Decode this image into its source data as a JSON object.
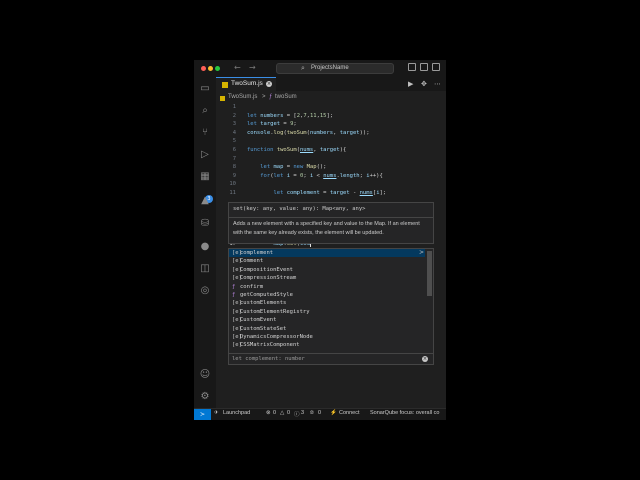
{
  "window": {
    "search_text": "ProjectsName",
    "colors": {
      "close": "#ff5f57",
      "minimize": "#febc2e",
      "zoom": "#28c840",
      "accent": "#0078d4"
    }
  },
  "nav": {
    "back_icon": "arrow-left-icon",
    "forward_icon": "arrow-right-icon"
  },
  "activity_bar": {
    "items": [
      "explorer-icon",
      "search-icon",
      "source-control-icon",
      "run-debug-icon",
      "extensions-icon",
      "azure-icon",
      "database-icon",
      "github-icon",
      "docker-icon",
      "copilot-icon"
    ],
    "extensions_badge": "3",
    "bottom": [
      "accounts-icon",
      "settings-icon"
    ]
  },
  "tab": {
    "label": "TwoSum.js"
  },
  "breadcrumb": {
    "file": "TwoSum.js",
    "separator": ">",
    "symbol": "twoSum"
  },
  "editor": {
    "lines": [
      {
        "n": "1",
        "text": ""
      },
      {
        "n": "2",
        "text": "let numbers = [2,7,11,15];"
      },
      {
        "n": "3",
        "text": "let target = 9;"
      },
      {
        "n": "4",
        "text": "console.log(twoSum(numbers, target));"
      },
      {
        "n": "5",
        "text": ""
      },
      {
        "n": "6",
        "text": "function twoSum(nums, target){"
      },
      {
        "n": "7",
        "text": ""
      },
      {
        "n": "8",
        "text": "    let map = new Map();"
      },
      {
        "n": "9",
        "text": "    for(let i = 0; i < nums.length; i++){"
      },
      {
        "n": "10",
        "text": ""
      },
      {
        "n": "11",
        "text": "        let complement = target - nums[i];"
      },
      {
        "n": "17",
        "text": "        map.set(com"
      }
    ]
  },
  "hover": {
    "signature": "set(key: any, value: any): Map<any, any>",
    "doc": "Adds a new element with a specified key and value to the Map. If an element with the same key already exists, the element will be updated."
  },
  "suggest": {
    "items": [
      {
        "kind": "[e]",
        "text": "complement"
      },
      {
        "kind": "[e]",
        "text": "Comment"
      },
      {
        "kind": "[e]",
        "text": "CompositionEvent"
      },
      {
        "kind": "[e]",
        "text": "CompressionStream"
      },
      {
        "kind": "ƒ",
        "text": "confirm"
      },
      {
        "kind": "ƒ",
        "text": "getComputedStyle"
      },
      {
        "kind": "[e]",
        "text": "customElements"
      },
      {
        "kind": "[e]",
        "text": "CustomElementRegistry"
      },
      {
        "kind": "[e]",
        "text": "CustomEvent"
      },
      {
        "kind": "[e]",
        "text": "CustomStateSet"
      },
      {
        "kind": "[e]",
        "text": "DynamicsCompressorNode"
      },
      {
        "kind": "[e]",
        "text": "CSSMatrixComponent"
      }
    ],
    "more_icon": ">",
    "footer": "let complement: number"
  },
  "status": {
    "launchpad": "Launchpad",
    "errors": "0",
    "warnings": "0",
    "infos": "3",
    "ports": "0",
    "connect": "Connect",
    "sonar": "SonarQube focus: overall co"
  }
}
